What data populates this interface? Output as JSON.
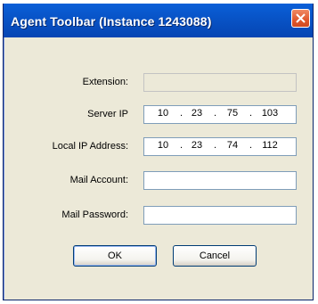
{
  "window": {
    "title": "Agent Toolbar (Instance 1243088)"
  },
  "form": {
    "extension": {
      "label": "Extension:",
      "value": ""
    },
    "server_ip": {
      "label": "Server IP",
      "octets": [
        "10",
        "23",
        "75",
        "103"
      ]
    },
    "local_ip": {
      "label": "Local IP Address:",
      "octets": [
        "10",
        "23",
        "74",
        "112"
      ]
    },
    "mail_account": {
      "label": "Mail Account:",
      "value": ""
    },
    "mail_password": {
      "label": "Mail Password:",
      "value": ""
    }
  },
  "buttons": {
    "ok_label": "OK",
    "cancel_label": "Cancel"
  },
  "colors": {
    "titlebar": "#0853c6",
    "close_button": "#e0582d",
    "window_face": "#ece9d8",
    "field_border": "#7f9db9"
  },
  "icons": {
    "close": "close-icon"
  }
}
